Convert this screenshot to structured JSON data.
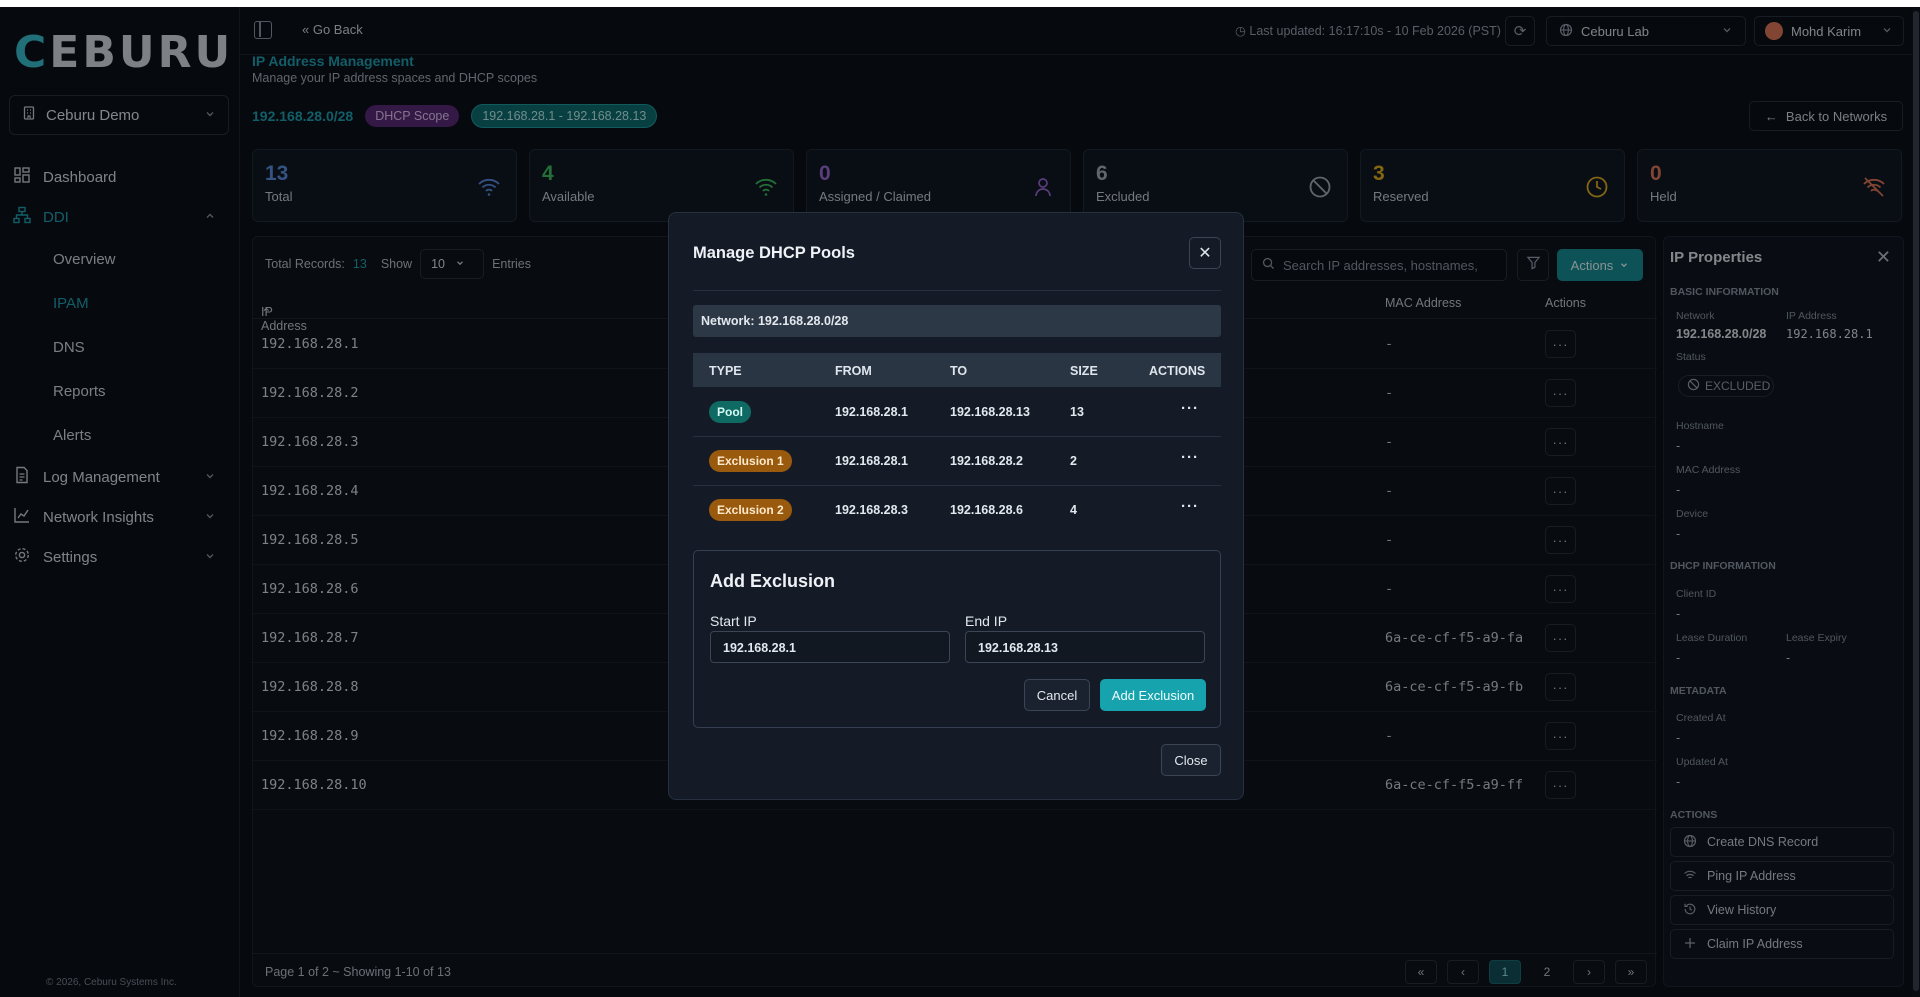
{
  "app": {
    "logo_first": "C",
    "logo_rest": "EBURU",
    "org": "Ceburu Demo",
    "copyright": "2026, Ceburu Systems Inc."
  },
  "sidebar": {
    "items": [
      {
        "label": "Dashboard",
        "icon": "dashboard-icon"
      },
      {
        "label": "DDI",
        "icon": "network-icon"
      },
      {
        "label": "Log Management",
        "icon": "document-icon"
      },
      {
        "label": "Network Insights",
        "icon": "chart-icon"
      },
      {
        "label": "Settings",
        "icon": "gear-icon"
      }
    ],
    "sub_items": [
      "Overview",
      "IPAM",
      "DNS",
      "Reports",
      "Alerts"
    ]
  },
  "topbar": {
    "go_back": "Go Back",
    "last_updated": "Last updated: 16:17:10s - 10 Feb 2026 (PST)",
    "lab": "Ceburu Lab",
    "user": "Mohd Karim"
  },
  "page": {
    "title": "IP Address Management",
    "subtitle": "Manage your IP address spaces and DHCP scopes",
    "subnet": "192.168.28.0/28",
    "scope_badge": "DHCP Scope",
    "range_badge": "192.168.28.1 - 192.168.28.13",
    "back_button": "Back to Networks"
  },
  "stats": [
    {
      "value": "13",
      "label": "Total",
      "color": "#5b8fe0",
      "icon": "wifi-icon"
    },
    {
      "value": "4",
      "label": "Available",
      "color": "#3fbf5e",
      "icon": "wifi-icon"
    },
    {
      "value": "0",
      "label": "Assigned / Claimed",
      "color": "#9b6ad8",
      "icon": "user-icon"
    },
    {
      "value": "6",
      "label": "Excluded",
      "color": "#a6b0bd",
      "icon": "ban-icon"
    },
    {
      "value": "3",
      "label": "Reserved",
      "color": "#e0b020",
      "icon": "clock-icon"
    },
    {
      "value": "0",
      "label": "Held",
      "color": "#e0785b",
      "icon": "wifi-off-icon"
    }
  ],
  "table": {
    "total_label": "Total Records:",
    "total_value": "13",
    "show_label": "Show",
    "show_value": "10",
    "entries_label": "Entries",
    "search_placeholder": "Search IP addresses, hostnames,",
    "actions_label": "Actions",
    "headers": {
      "ip": "IP Address",
      "mac": "MAC Address",
      "actions": "Actions"
    },
    "rows": [
      {
        "ip": "192.168.28.1",
        "mac": "-"
      },
      {
        "ip": "192.168.28.2",
        "mac": "-"
      },
      {
        "ip": "192.168.28.3",
        "mac": "-"
      },
      {
        "ip": "192.168.28.4",
        "mac": "-"
      },
      {
        "ip": "192.168.28.5",
        "mac": "-"
      },
      {
        "ip": "192.168.28.6",
        "mac": "-"
      },
      {
        "ip": "192.168.28.7",
        "mac": "6a-ce-cf-f5-a9-fa"
      },
      {
        "ip": "192.168.28.8",
        "mac": "6a-ce-cf-f5-a9-fb"
      },
      {
        "ip": "192.168.28.9",
        "mac": "-"
      },
      {
        "ip": "192.168.28.10",
        "mac": "6a-ce-cf-f5-a9-ff"
      }
    ],
    "footer_info": "Page 1 of 2 ~ Showing 1-10 of 13",
    "pages": [
      "1",
      "2"
    ]
  },
  "props": {
    "title": "IP Properties",
    "basic": "Basic Information",
    "network_k": "Network",
    "network_v": "192.168.28.0/28",
    "ip_k": "IP Address",
    "ip_v": "192.168.28.1",
    "status_k": "Status",
    "status_v": "EXCLUDED",
    "hostname_k": "Hostname",
    "hostname_v": "-",
    "mac_k": "MAC Address",
    "mac_v": "-",
    "device_k": "Device",
    "device_v": "-",
    "dhcp": "DHCP Information",
    "client_k": "Client ID",
    "client_v": "-",
    "lease_dur_k": "Lease Duration",
    "lease_dur_v": "-",
    "lease_exp_k": "Lease Expiry",
    "lease_exp_v": "-",
    "meta": "Metadata",
    "created_k": "Created At",
    "created_v": "-",
    "updated_k": "Updated At",
    "updated_v": "-",
    "actions": "Actions",
    "action_items": [
      "Create DNS Record",
      "Ping IP Address",
      "View History",
      "Claim IP Address"
    ]
  },
  "modal": {
    "title": "Manage DHCP Pools",
    "network": "Network: 192.168.28.0/28",
    "headers": [
      "TYPE",
      "FROM",
      "TO",
      "SIZE",
      "ACTIONS"
    ],
    "rows": [
      {
        "type": "Pool",
        "from": "192.168.28.1",
        "to": "192.168.28.13",
        "size": "13"
      },
      {
        "type": "Exclusion 1",
        "from": "192.168.28.1",
        "to": "192.168.28.2",
        "size": "2"
      },
      {
        "type": "Exclusion 2",
        "from": "192.168.28.3",
        "to": "192.168.28.6",
        "size": "4"
      }
    ],
    "add_title": "Add Exclusion",
    "start_label": "Start IP",
    "start_value": "192.168.28.1",
    "end_label": "End IP",
    "end_value": "192.168.28.13",
    "cancel": "Cancel",
    "add": "Add Exclusion",
    "close": "Close"
  }
}
